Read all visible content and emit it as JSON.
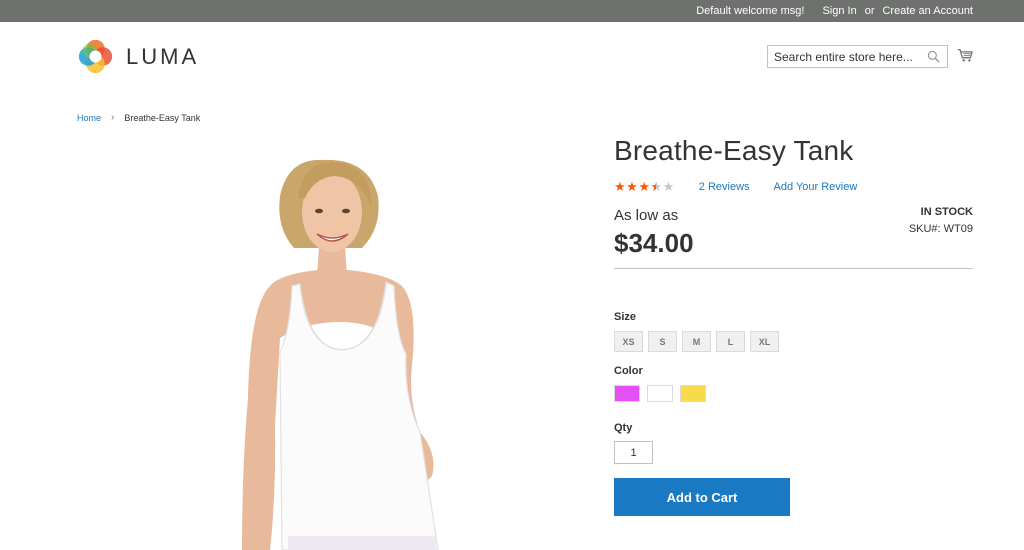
{
  "header": {
    "welcome": "Default welcome msg!",
    "sign_in": "Sign In",
    "or": "or",
    "create_account": "Create an Account",
    "logo_text": "LUMA",
    "search_placeholder": "Search entire store here...",
    "topbar_color": "#6e716e"
  },
  "breadcrumb": {
    "home": "Home",
    "separator": "›",
    "current": "Breathe-Easy Tank"
  },
  "product": {
    "name": "Breathe-Easy Tank",
    "rating": 3.5,
    "rating_max": 5,
    "reviews": "2  Reviews",
    "add_review": "Add Your Review",
    "price_prefix": "As low as",
    "price": "$34.00",
    "stock": "IN STOCK",
    "sku": "SKU#:   WT09",
    "size_label": "Size",
    "sizes": [
      "XS",
      "S",
      "M",
      "L",
      "XL"
    ],
    "color_label": "Color",
    "colors": [
      "#e252f4",
      "#ffffff",
      "#f7db4a"
    ],
    "qty_label": "Qty",
    "qty": "1",
    "add_to_cart": "Add to Cart",
    "accent_color": "#1979c3"
  }
}
